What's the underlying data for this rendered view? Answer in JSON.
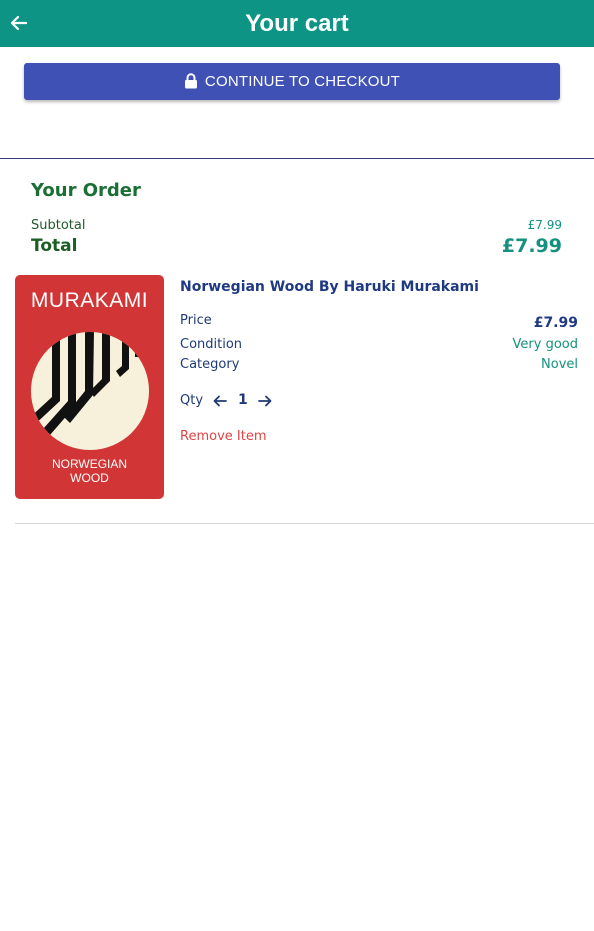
{
  "header": {
    "title": "Your cart",
    "back_icon": "arrow-left-icon"
  },
  "checkout": {
    "label": "CONTINUE TO CHECKOUT",
    "icon": "lock-icon"
  },
  "order": {
    "title": "Your Order",
    "subtotal_label": "Subtotal",
    "subtotal_value": "£7.99",
    "total_label": "Total",
    "total_value": "£7.99"
  },
  "item": {
    "cover": {
      "author": "MURAKAMI",
      "title_line1": "NORWEGIAN",
      "title_line2": "WOOD"
    },
    "title": "Norwegian Wood By Haruki Murakami",
    "price_label": "Price",
    "price_value": "£7.99",
    "condition_label": "Condition",
    "condition_value": "Very good",
    "category_label": "Category",
    "category_value": "Novel",
    "qty_label": "Qty",
    "qty_value": "1",
    "remove_label": "Remove Item"
  },
  "colors": {
    "header_bg": "#0e9484",
    "checkout_bg": "#3f51b5",
    "order_green": "#1b6f34",
    "price_teal": "#15907f",
    "title_navy": "#1f3a82",
    "remove_red": "#e04545",
    "cover_red": "#d13535"
  }
}
